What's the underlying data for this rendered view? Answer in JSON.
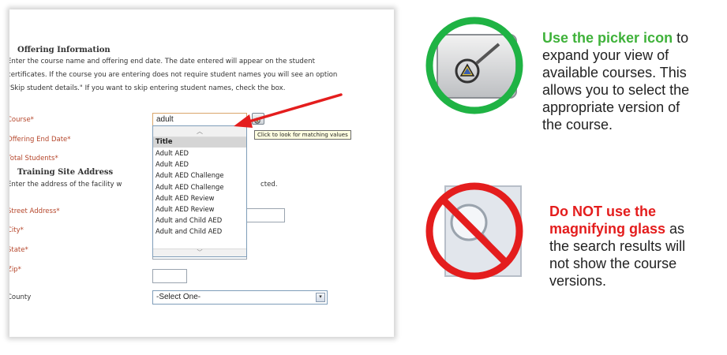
{
  "form": {
    "offering_title": "Offering Information",
    "offering_text": [
      "Enter the course name and offering end date. The date entered will appear on the student",
      "certificates. If the course you are entering does not require student names you will see an option",
      "\"Skip student details.\" If you want to skip entering student names, check the box."
    ],
    "course_label": "Course*",
    "course_value": "adult",
    "end_date_label": "Offering End Date*",
    "total_students_label": "Total Students*",
    "site_title": "Training Site Address",
    "site_text": "Enter the address of the facility where the course will be conducted.",
    "site_text_suffix": "cted.",
    "street_label": "Street Address*",
    "city_label": "City*",
    "state_label": "State*",
    "zip_label": "Zip*",
    "county_label": "County",
    "county_value": "-Select One-",
    "tooltip": "Click to look for matching values",
    "dropdown": {
      "header": "Title",
      "items": [
        "Adult AED",
        "Adult AED",
        "Adult AED Challenge",
        "Adult AED Challenge",
        "Adult AED Review",
        "Adult AED Review",
        "Adult and Child AED",
        "Adult and Child AED"
      ]
    }
  },
  "instructions": {
    "use_highlight": "Use the picker icon",
    "use_rest_1": " to",
    "use_lines": [
      "expand your view of",
      "available courses. This",
      "allows you to select the",
      "appropriate version of",
      "the course."
    ],
    "dont_line1": "Do NOT use the",
    "dont_highlight2": "magnifying glass",
    "dont_rest2": " as",
    "dont_lines": [
      "the search results will",
      "not show the course",
      "versions."
    ]
  },
  "colors": {
    "good": "#3fb23a",
    "bad": "#e41d1d",
    "required_label": "#b5462b"
  },
  "icons": {
    "picker": "picker-icon",
    "magnifier": "magnifying-glass-icon",
    "arrow": "red-arrow"
  }
}
